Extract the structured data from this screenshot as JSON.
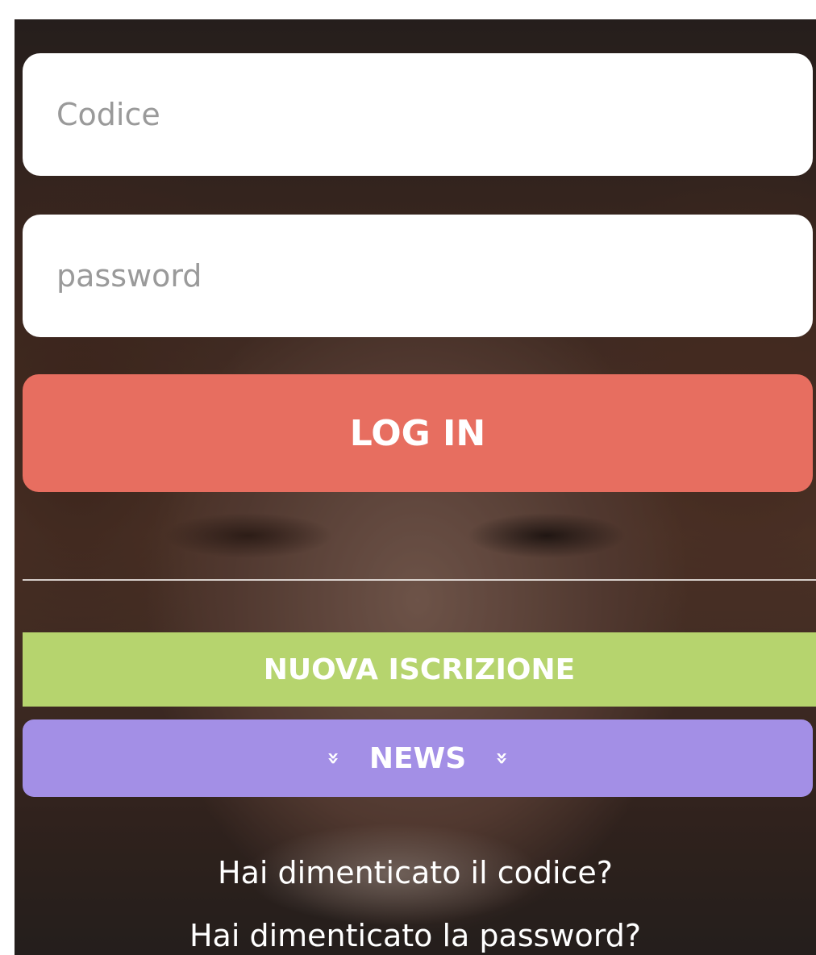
{
  "login_form": {
    "code_placeholder": "Codice",
    "code_value": "",
    "password_placeholder": "password",
    "password_value": "",
    "login_label": "LOG IN"
  },
  "actions": {
    "new_registration_label": "NUOVA ISCRIZIONE",
    "news_label": "NEWS",
    "news_icon": "double-chevron-down-icon",
    "chevron_glyph": "»"
  },
  "links": {
    "forgot_code": "Hai dimenticato il codice?",
    "forgot_password": "Hai dimenticato la password?"
  },
  "colors": {
    "login_button": "#e76e60",
    "new_registration_button": "#b6d46e",
    "news_button": "#a38fe6",
    "field_background": "#ffffff"
  }
}
